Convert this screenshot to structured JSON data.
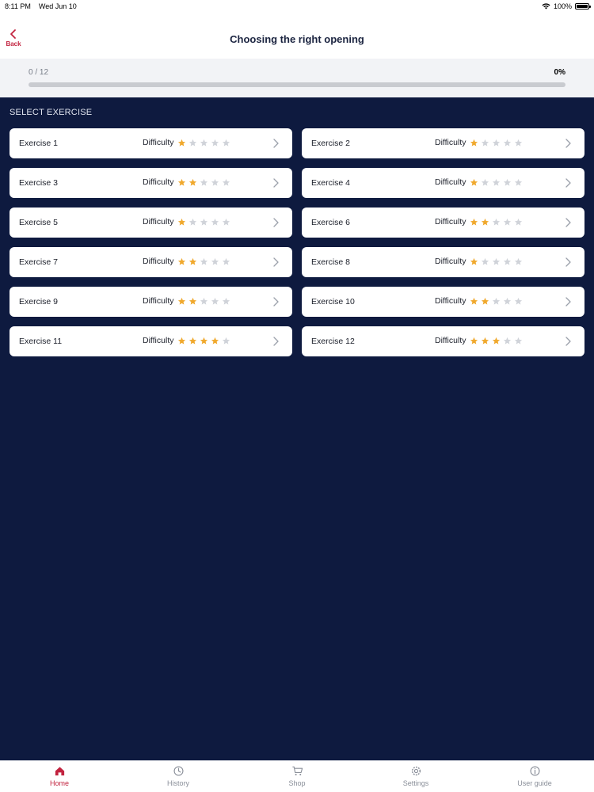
{
  "status_bar": {
    "time": "8:11 PM",
    "date": "Wed Jun 10",
    "battery": "100%"
  },
  "nav": {
    "back_label": "Back",
    "title": "Choosing the right opening"
  },
  "progress": {
    "count_text": "0 / 12",
    "percent_text": "0%",
    "fraction": 0
  },
  "section_label": "SELECT EXERCISE",
  "difficulty_label": "Difficulty",
  "max_stars": 5,
  "exercises": [
    {
      "name": "Exercise 1",
      "difficulty": 1
    },
    {
      "name": "Exercise 2",
      "difficulty": 1
    },
    {
      "name": "Exercise 3",
      "difficulty": 2
    },
    {
      "name": "Exercise 4",
      "difficulty": 1
    },
    {
      "name": "Exercise 5",
      "difficulty": 1
    },
    {
      "name": "Exercise 6",
      "difficulty": 2
    },
    {
      "name": "Exercise 7",
      "difficulty": 2
    },
    {
      "name": "Exercise 8",
      "difficulty": 1
    },
    {
      "name": "Exercise 9",
      "difficulty": 2
    },
    {
      "name": "Exercise 10",
      "difficulty": 2
    },
    {
      "name": "Exercise 11",
      "difficulty": 4
    },
    {
      "name": "Exercise 12",
      "difficulty": 3
    }
  ],
  "tabs": [
    {
      "label": "Home",
      "icon": "home-icon",
      "active": true
    },
    {
      "label": "History",
      "icon": "history-icon",
      "active": false
    },
    {
      "label": "Shop",
      "icon": "cart-icon",
      "active": false
    },
    {
      "label": "Settings",
      "icon": "gear-icon",
      "active": false
    },
    {
      "label": "User guide",
      "icon": "info-icon",
      "active": false
    }
  ],
  "colors": {
    "accent": "#c2233f",
    "background": "#0e1a3f",
    "star_filled": "#f0a92e",
    "star_empty": "#d0d3d9",
    "tab_inactive": "#8a8f99"
  }
}
